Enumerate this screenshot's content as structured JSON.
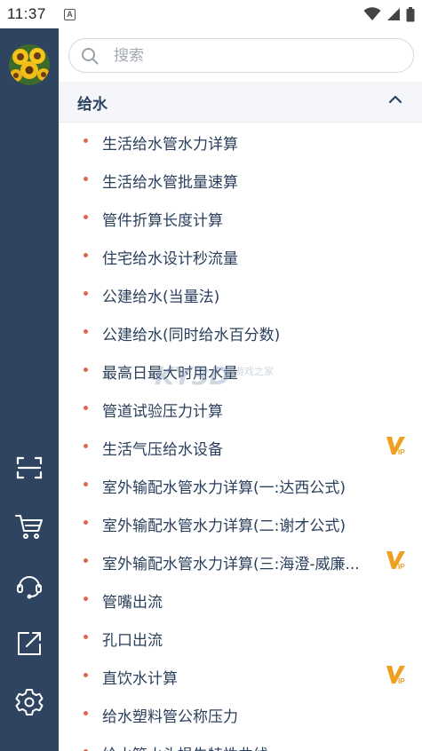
{
  "status_bar": {
    "time": "11:37",
    "notification_letter": "A"
  },
  "search": {
    "placeholder": "搜索"
  },
  "section": {
    "title": "给水"
  },
  "items": [
    {
      "label": "生活给水管水力详算",
      "vip": false
    },
    {
      "label": "生活给水管批量速算",
      "vip": false
    },
    {
      "label": "管件折算长度计算",
      "vip": false
    },
    {
      "label": "住宅给水设计秒流量",
      "vip": false
    },
    {
      "label": "公建给水(当量法)",
      "vip": false
    },
    {
      "label": "公建给水(同时给水百分数)",
      "vip": false
    },
    {
      "label": "最高日最大时用水量",
      "vip": false
    },
    {
      "label": "管道试验压力计算",
      "vip": false
    },
    {
      "label": "生活气压给水设备",
      "vip": true
    },
    {
      "label": "室外输配水管水力详算(一:达西公式)",
      "vip": false
    },
    {
      "label": "室外输配水管水力详算(二:谢才公式)",
      "vip": false
    },
    {
      "label": "室外输配水管水力详算(三:海澄-威廉...",
      "vip": true
    },
    {
      "label": "管嘴出流",
      "vip": false
    },
    {
      "label": "孔口出流",
      "vip": false
    },
    {
      "label": "直饮水计算",
      "vip": true
    },
    {
      "label": "给水塑料管公称压力",
      "vip": false
    },
    {
      "label": "给水管水头损失特性曲线",
      "vip": false
    }
  ],
  "sidebar": {
    "icons": [
      "scan-icon",
      "cart-icon",
      "support-headset-icon",
      "share-icon",
      "settings-icon"
    ]
  },
  "watermark": {
    "text": "KY3D",
    "subtext": "游戏之家"
  },
  "colors": {
    "sidebar": "#2e4461",
    "bullet": "#e0664e",
    "vip": "#f0a020",
    "text": "#2a3f5c"
  }
}
